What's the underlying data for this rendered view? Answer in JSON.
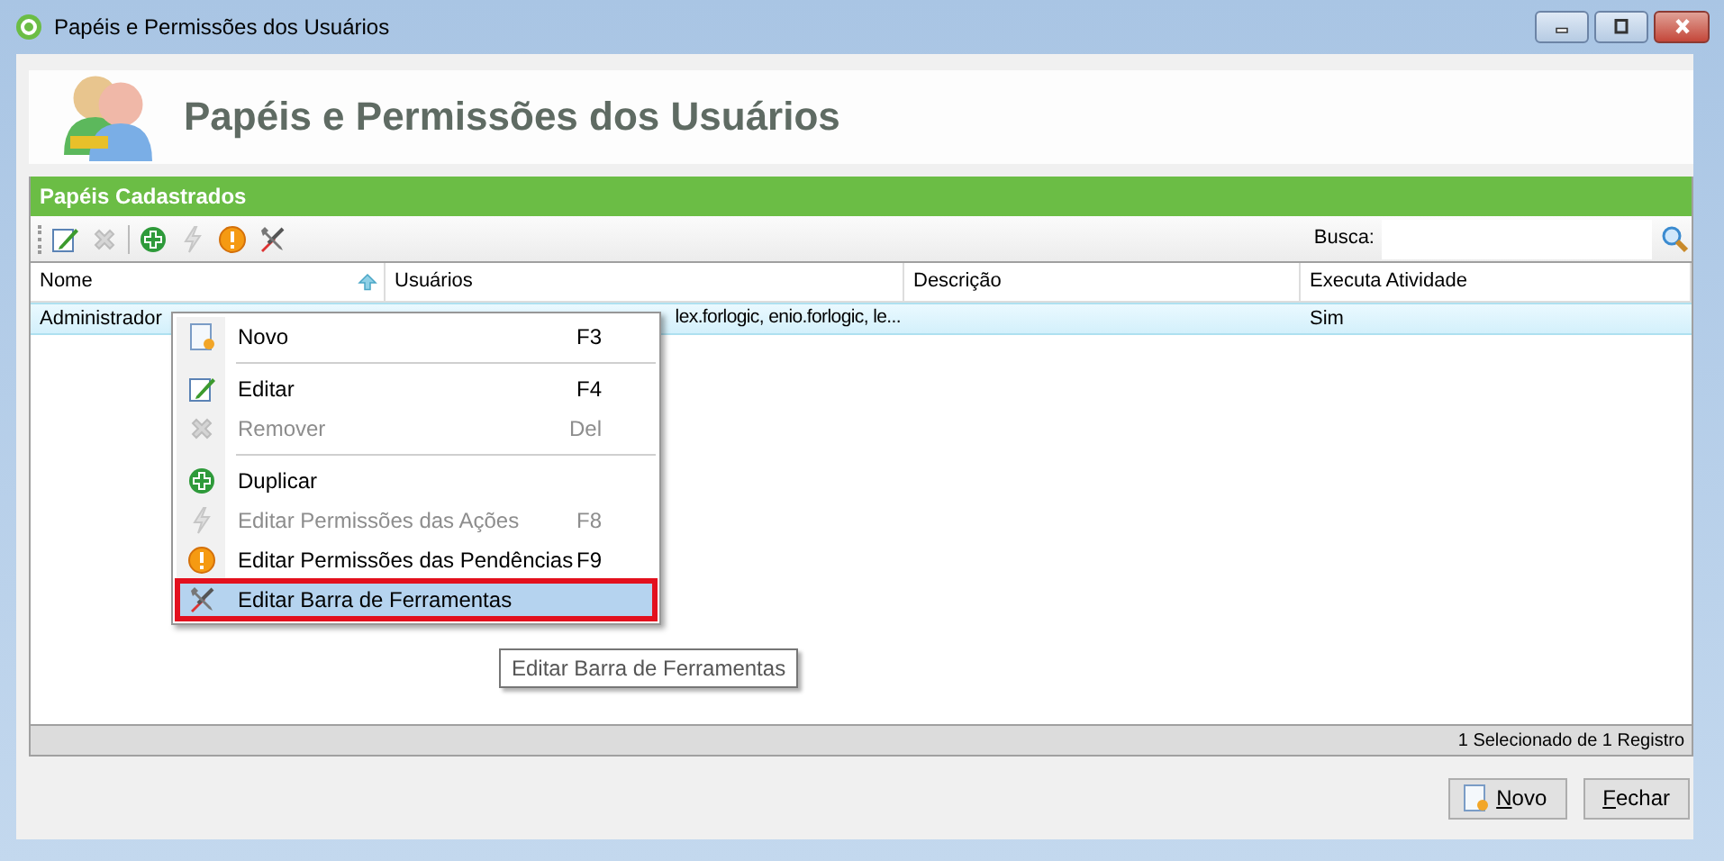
{
  "window": {
    "title": "Papéis e Permissões dos Usuários"
  },
  "header": {
    "title": "Papéis e Permissões dos Usuários"
  },
  "panel": {
    "title": "Papéis Cadastrados"
  },
  "toolbar": {
    "buttons": [
      {
        "disabled": false
      },
      {
        "disabled": true
      },
      {
        "disabled": false
      },
      {
        "disabled": true
      },
      {
        "disabled": false
      },
      {
        "disabled": false
      }
    ],
    "search_label": "Busca:"
  },
  "table": {
    "columns": [
      {
        "label": "Nome",
        "sorted": true
      },
      {
        "label": "Usuários",
        "sorted": false
      },
      {
        "label": "Descrição",
        "sorted": false
      },
      {
        "label": "Executa Atividade",
        "sorted": false
      }
    ],
    "rows": [
      {
        "selected": true,
        "cells": [
          "Administrador",
          "lex.forlogic, enio.forlogic, le...",
          "",
          "Sim"
        ]
      }
    ]
  },
  "status_bar": "1 Selecionado de 1 Registro",
  "context_menu": [
    {
      "kind": "item",
      "label": "Novo",
      "shortcut": "F3",
      "disabled": false,
      "selected": false
    },
    {
      "kind": "separator"
    },
    {
      "kind": "item",
      "label": "Editar",
      "shortcut": "F4",
      "disabled": false,
      "selected": false
    },
    {
      "kind": "item",
      "label": "Remover",
      "shortcut": "Del",
      "disabled": true,
      "selected": false
    },
    {
      "kind": "separator"
    },
    {
      "kind": "item",
      "label": "Duplicar",
      "disabled": false,
      "selected": false
    },
    {
      "kind": "item",
      "label": "Editar Permissões das Ações",
      "shortcut": "F8",
      "disabled": true,
      "selected": false
    },
    {
      "kind": "item",
      "label": "Editar Permissões das Pendências",
      "shortcut": "F9",
      "disabled": false,
      "selected": false
    },
    {
      "kind": "item",
      "label": "Editar Barra de Ferramentas",
      "disabled": false,
      "selected": true
    }
  ],
  "tooltip": "Editar Barra de Ferramentas",
  "buttons": [
    {
      "label": "Novo"
    },
    {
      "label": "Fechar"
    }
  ]
}
